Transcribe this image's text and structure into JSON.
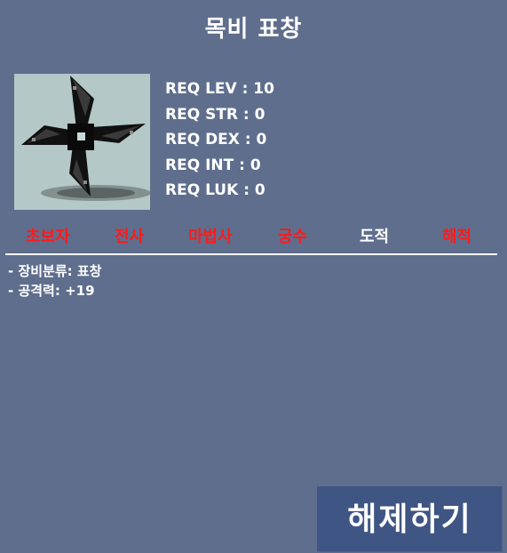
{
  "item": {
    "name": "목비 표창",
    "icon": "throwing-star-icon"
  },
  "requirements": [
    {
      "label": "REQ LEV : 10"
    },
    {
      "label": "REQ STR : 0"
    },
    {
      "label": "REQ DEX : 0"
    },
    {
      "label": "REQ INT : 0"
    },
    {
      "label": "REQ LUK : 0"
    }
  ],
  "jobs": [
    {
      "label": "초보자",
      "status": "unavailable",
      "color": "#ff1a1a"
    },
    {
      "label": "전사",
      "status": "unavailable",
      "color": "#ff1a1a"
    },
    {
      "label": "마법사",
      "status": "unavailable",
      "color": "#ff1a1a"
    },
    {
      "label": "궁수",
      "status": "unavailable",
      "color": "#ff1a1a"
    },
    {
      "label": "도적",
      "status": "available",
      "color": "#ffffff"
    },
    {
      "label": "해적",
      "status": "unavailable",
      "color": "#ff1a1a"
    }
  ],
  "description": [
    "- 장비분류: 표창",
    "- 공격력: +19"
  ],
  "actions": {
    "unequip_label": "해제하기"
  },
  "colors": {
    "background": "#5f6e8d",
    "button": "#3f5583",
    "unavailable": "#ff1a1a",
    "available": "#ffffff"
  }
}
